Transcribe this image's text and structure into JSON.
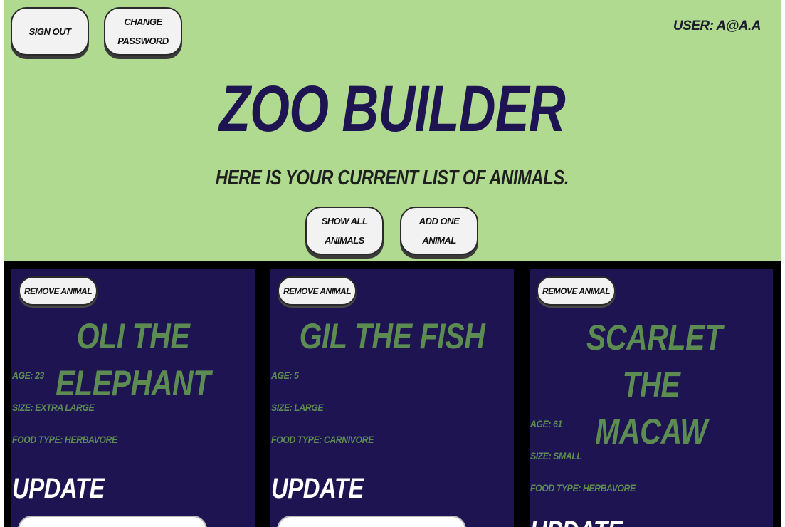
{
  "header": {
    "sign_out_label": "Sign Out",
    "change_password_label": "Change Password",
    "user_label": "User: a@a.a",
    "title": "Zoo Builder",
    "subtitle": "Here is your current list of animals.",
    "show_all_label": "Show All Animals",
    "add_one_label": "Add One Animal"
  },
  "animals": [
    {
      "remove_label": "Remove Animal",
      "name": "Oli the Elephant",
      "age": "Age: 23",
      "size": "Size: Extra Large",
      "food": "Food Type: Herbavore",
      "update_label": "Update"
    },
    {
      "remove_label": "Remove Animal",
      "name": "Gil the Fish",
      "age": "Age: 5",
      "size": "Size: Large",
      "food": "Food Type: Carnivore",
      "update_label": "Update"
    },
    {
      "remove_label": "Remove Animal",
      "name": "Scarlet the Macaw",
      "age": "Age: 61",
      "size": "Size: Small",
      "food": "Food Type: Herbavore",
      "update_label": "Update"
    }
  ],
  "colors": {
    "background": "#b0da8f",
    "title": "#1e1452",
    "card": "#1e1452",
    "card_text": "#5d8c52",
    "button": "#f2f2f2"
  }
}
